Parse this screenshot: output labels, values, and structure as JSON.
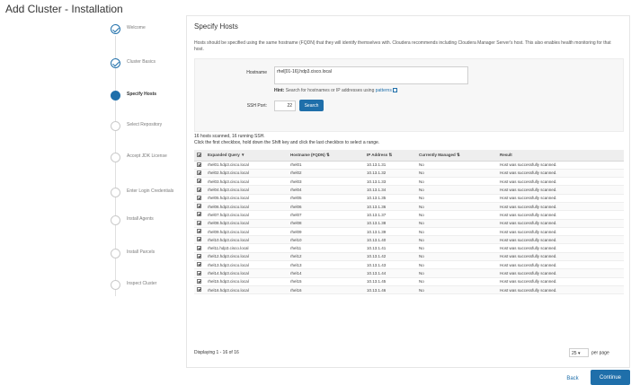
{
  "window": {
    "title": "Add Cluster - Installation"
  },
  "steps": [
    {
      "label": "Welcome",
      "state": "done"
    },
    {
      "label": "Cluster Basics",
      "state": "done"
    },
    {
      "label": "Specify Hosts",
      "state": "active"
    },
    {
      "label": "Select Repository",
      "state": "pending"
    },
    {
      "label": "Accept JDK License",
      "state": "pending"
    },
    {
      "label": "Enter Login Credentials",
      "state": "pending"
    },
    {
      "label": "Install Agents",
      "state": "pending"
    },
    {
      "label": "Install Parcels",
      "state": "pending"
    },
    {
      "label": "Inspect Cluster",
      "state": "pending"
    }
  ],
  "main": {
    "title": "Specify Hosts",
    "intro": "Hosts should be specified using the same hostname (FQDN) that they will identify themselves with. Cloudera recommends including Cloudera Manager Server's host. This also enables health monitoring for that host.",
    "hostname_label": "Hostname",
    "hostname_value": "rhel[01-16].hdp3.cisco.local",
    "hint_bold": "Hint:",
    "hint_text": "Search for hostnames or IP addresses using",
    "hint_link": "patterns",
    "ssh_label": "SSH Port:",
    "ssh_value": "22",
    "search_label": "Search",
    "scan_line1": "16 hosts scanned, 16 running SSH.",
    "scan_line2": "Click the first checkbox, hold down the Shift key and click the last checkbox to select a range.",
    "columns": [
      "Expanded Query",
      "Hostname (FQDN)",
      "IP Address",
      "Currently Managed",
      "Result"
    ],
    "rows": [
      {
        "query": "rhel01.hdp3.cisco.local",
        "hostname": "rhel01",
        "ip": "10.13.1.31",
        "managed": "No",
        "result": "Host was successfully scanned."
      },
      {
        "query": "rhel02.hdp3.cisco.local",
        "hostname": "rhel02",
        "ip": "10.13.1.32",
        "managed": "No",
        "result": "Host was successfully scanned."
      },
      {
        "query": "rhel03.hdp3.cisco.local",
        "hostname": "rhel03",
        "ip": "10.13.1.33",
        "managed": "No",
        "result": "Host was successfully scanned."
      },
      {
        "query": "rhel04.hdp3.cisco.local",
        "hostname": "rhel04",
        "ip": "10.13.1.34",
        "managed": "No",
        "result": "Host was successfully scanned."
      },
      {
        "query": "rhel05.hdp3.cisco.local",
        "hostname": "rhel05",
        "ip": "10.13.1.35",
        "managed": "No",
        "result": "Host was successfully scanned."
      },
      {
        "query": "rhel06.hdp3.cisco.local",
        "hostname": "rhel06",
        "ip": "10.13.1.36",
        "managed": "No",
        "result": "Host was successfully scanned."
      },
      {
        "query": "rhel07.hdp3.cisco.local",
        "hostname": "rhel07",
        "ip": "10.13.1.37",
        "managed": "No",
        "result": "Host was successfully scanned."
      },
      {
        "query": "rhel08.hdp3.cisco.local",
        "hostname": "rhel08",
        "ip": "10.13.1.38",
        "managed": "No",
        "result": "Host was successfully scanned."
      },
      {
        "query": "rhel09.hdp3.cisco.local",
        "hostname": "rhel09",
        "ip": "10.13.1.39",
        "managed": "No",
        "result": "Host was successfully scanned."
      },
      {
        "query": "rhel10.hdp3.cisco.local",
        "hostname": "rhel10",
        "ip": "10.13.1.40",
        "managed": "No",
        "result": "Host was successfully scanned."
      },
      {
        "query": "rhel11.hdp3.cisco.local",
        "hostname": "rhel11",
        "ip": "10.13.1.41",
        "managed": "No",
        "result": "Host was successfully scanned."
      },
      {
        "query": "rhel12.hdp3.cisco.local",
        "hostname": "rhel12",
        "ip": "10.13.1.42",
        "managed": "No",
        "result": "Host was successfully scanned."
      },
      {
        "query": "rhel13.hdp3.cisco.local",
        "hostname": "rhel13",
        "ip": "10.13.1.43",
        "managed": "No",
        "result": "Host was successfully scanned."
      },
      {
        "query": "rhel14.hdp3.cisco.local",
        "hostname": "rhel14",
        "ip": "10.13.1.44",
        "managed": "No",
        "result": "Host was successfully scanned."
      },
      {
        "query": "rhel15.hdp3.cisco.local",
        "hostname": "rhel15",
        "ip": "10.13.1.45",
        "managed": "No",
        "result": "Host was successfully scanned."
      },
      {
        "query": "rhel16.hdp3.cisco.local",
        "hostname": "rhel16",
        "ip": "10.13.1.46",
        "managed": "No",
        "result": "Host was successfully scanned."
      }
    ],
    "displaying": "Displaying 1 - 16 of 16",
    "per_page_value": "25",
    "per_page_label": "per page"
  },
  "footer": {
    "back_label": "Back",
    "continue_label": "Continue"
  },
  "colors": {
    "accent": "#1f6faa"
  }
}
